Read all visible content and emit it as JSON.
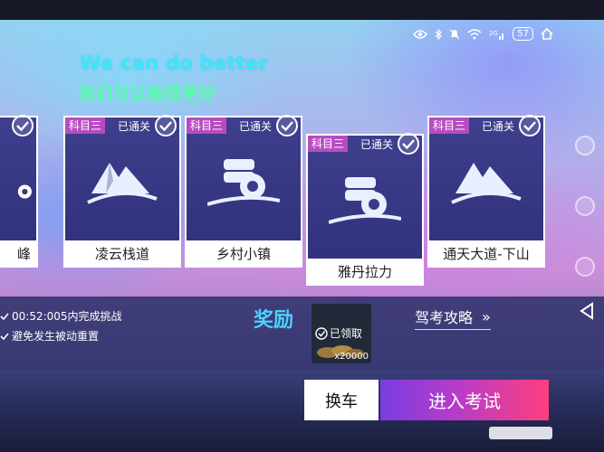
{
  "status_bar": {
    "battery": "57",
    "icons": [
      "eye-icon",
      "bluetooth-icon",
      "mute-icon",
      "wifi-icon",
      "signal-2g-icon",
      "battery-icon",
      "home-icon"
    ]
  },
  "slogan": {
    "en": "We can do better",
    "zh": "我们可以做得更好"
  },
  "cards": [
    {
      "title": "峰",
      "tag": "",
      "status": "",
      "emblem": "road-mark-icon"
    },
    {
      "title": "凌云栈道",
      "tag": "科目三",
      "status": "已通关",
      "emblem": "mountain-icon"
    },
    {
      "title": "乡村小镇",
      "tag": "科目三",
      "status": "已通关",
      "emblem": "tire-stack-icon"
    },
    {
      "title": "雅丹拉力",
      "tag": "科目三",
      "status": "已通关",
      "emblem": "tire-stack-icon",
      "selected": true
    },
    {
      "title": "通天大道-下山",
      "tag": "科目三",
      "status": "已通关",
      "emblem": "mountain-icon"
    }
  ],
  "conditions": [
    "00:52:005内完成挑战",
    "避免发生被动重置"
  ],
  "reward": {
    "label": "奖励",
    "claimed": "已领取",
    "quantity": "x20000"
  },
  "guide": {
    "label": "驾考攻略",
    "arrow": "»"
  },
  "buttons": {
    "change": "换车",
    "enter": "进入考试"
  },
  "colors": {
    "accent_cyan": "#38e8ff",
    "accent_green": "#55ffa8",
    "tag_purple": "#b74cc0",
    "card_bg": "#3a3b88"
  }
}
